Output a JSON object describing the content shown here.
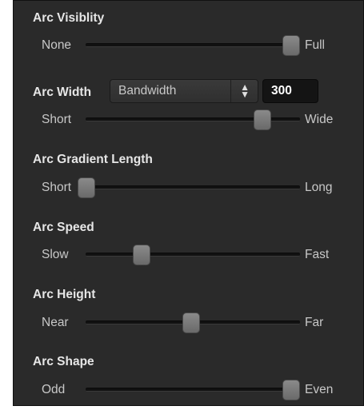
{
  "panel": {
    "sections": [
      {
        "title": "Arc Visiblity",
        "min_label": "None",
        "max_label": "Full",
        "value": 1.0
      },
      {
        "title": "Arc Width",
        "min_label": "Short",
        "max_label": "Wide",
        "value": 0.855
      },
      {
        "title": "Arc Gradient Length",
        "min_label": "Short",
        "max_label": "Long",
        "value": 0.0
      },
      {
        "title": "Arc Speed",
        "min_label": "Slow",
        "max_label": "Fast",
        "value": 0.24
      },
      {
        "title": "Arc Height",
        "min_label": "Near",
        "max_label": "Far",
        "value": 0.49
      },
      {
        "title": "Arc Shape",
        "min_label": "Odd",
        "max_label": "Even",
        "value": 1.0
      }
    ],
    "width_control": {
      "select_value": "Bandwidth",
      "number_value": "300",
      "arrow_icon": "updown-chevron-icon"
    }
  }
}
